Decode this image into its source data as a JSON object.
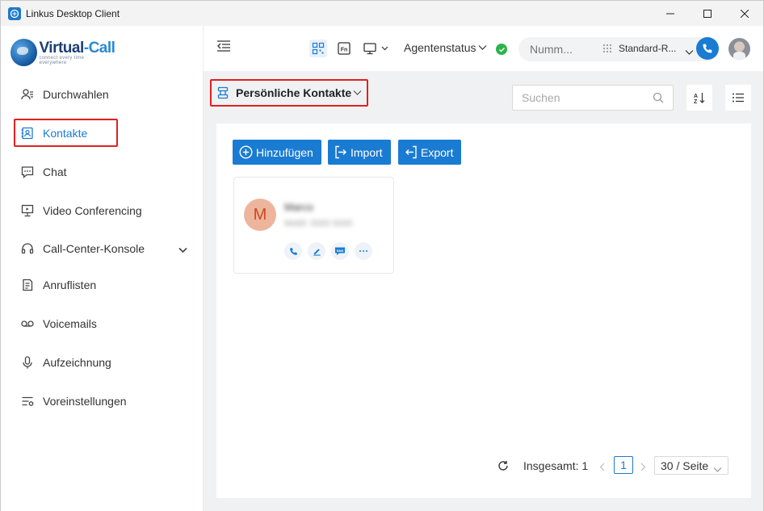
{
  "window": {
    "title": "Linkus Desktop Client",
    "icon": "app-icon",
    "controls": [
      "minimize-icon",
      "maximize-icon",
      "close-icon"
    ]
  },
  "logo": {
    "brand_part1": "Virtual",
    "brand_part2": "-Call",
    "tagline": "connect every time · everywhere"
  },
  "sidebar": {
    "items": [
      {
        "label": "Durchwahlen",
        "icon": "extension-icon"
      },
      {
        "label": "Kontakte",
        "icon": "contacts-icon",
        "active": true
      },
      {
        "label": "Chat",
        "icon": "chat-icon"
      },
      {
        "label": "Video Conferencing",
        "icon": "video-conference-icon"
      },
      {
        "label": "Call-Center-Konsole",
        "icon": "headset-icon",
        "expandable": true
      },
      {
        "label": "Anruflisten",
        "icon": "call-log-icon"
      },
      {
        "label": "Voicemails",
        "icon": "voicemail-icon"
      },
      {
        "label": "Aufzeichnung",
        "icon": "microphone-icon"
      },
      {
        "label": "Voreinstellungen",
        "icon": "settings-icon"
      }
    ]
  },
  "header": {
    "collapse_icon": "collapse-menu-icon",
    "agent_status_label": "Agentenstatus",
    "status": "online",
    "number_placeholder": "Numm...",
    "route_label": "Standard-R...",
    "accent": "#1a7bd2",
    "status_color": "#2bb44a"
  },
  "contacts": {
    "selector_label": "Persönliche Kontakte",
    "search_placeholder": "Suchen",
    "buttons": {
      "add": "Hinzufügen",
      "import": "Import",
      "export": "Export"
    },
    "items": [
      {
        "initial": "M",
        "name": "Marco",
        "info": "Mobil: 0000 0000"
      }
    ]
  },
  "pagination": {
    "total_label": "Insgesamt: 1",
    "current_page": "1",
    "page_size": "30 / Seite"
  }
}
